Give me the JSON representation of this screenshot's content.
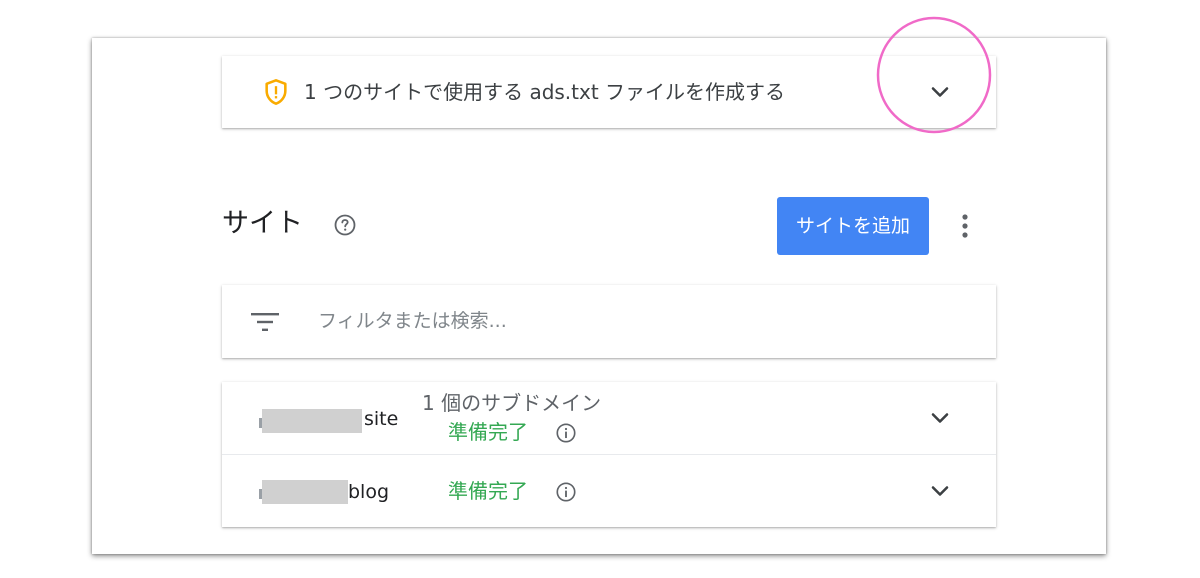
{
  "banner": {
    "message": "1 つのサイトで使用する ads.txt ファイルを作成する",
    "icon": "warning-shield-icon",
    "icon_color": "#f9ab00"
  },
  "sites_section": {
    "title": "サイト",
    "help_icon": "help-icon",
    "add_button_label": "サイトを追加",
    "more_icon": "more-vert-icon",
    "accent_color": "#4285f4"
  },
  "filter": {
    "icon": "filter-icon",
    "placeholder": "フィルタまたは検索..."
  },
  "sites": [
    {
      "name_suffix": "site",
      "subdomain_info": "1 個のサブドメイン",
      "status": "準備完了"
    },
    {
      "name_suffix": "blog",
      "status": "準備完了"
    }
  ],
  "status_color": "#34a853",
  "annotation_color": "#f06ac8"
}
